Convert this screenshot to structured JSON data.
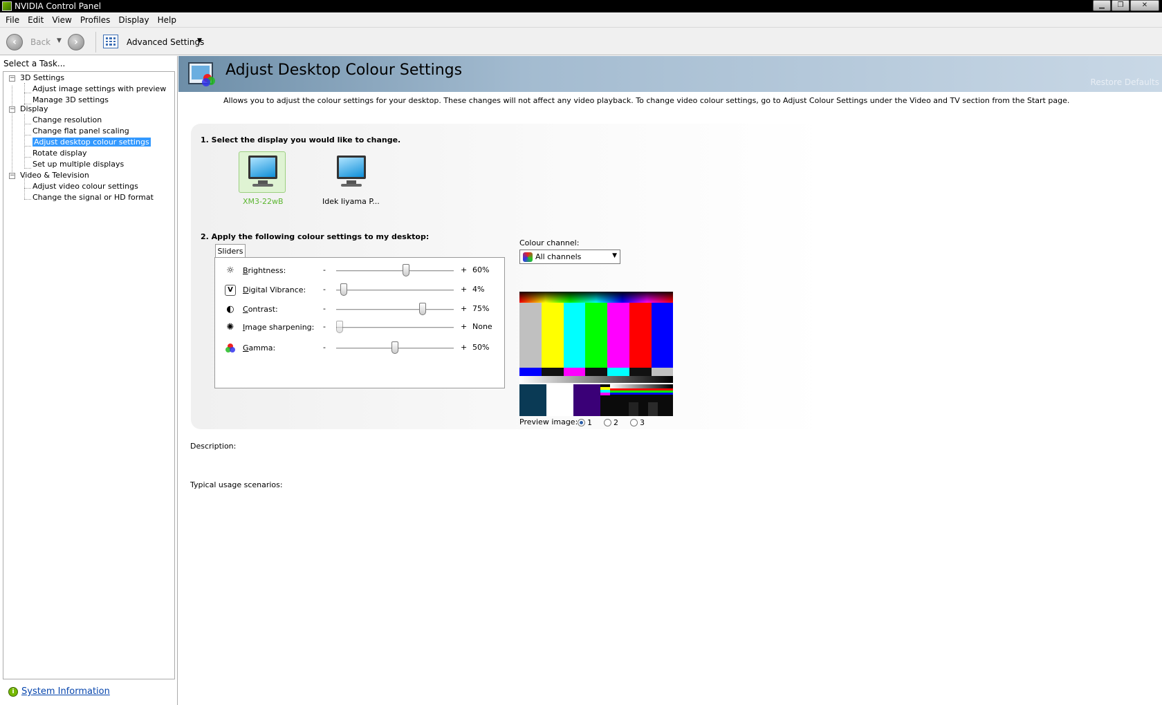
{
  "window": {
    "title": "NVIDIA Control Panel",
    "controls": [
      "minimize",
      "maximize",
      "close"
    ]
  },
  "menubar": [
    "File",
    "Edit",
    "View",
    "Profiles",
    "Display",
    "Help"
  ],
  "toolbar": {
    "back_label": "Back",
    "view_label": "Advanced Settings"
  },
  "sidebar": {
    "header": "Select a Task...",
    "tree": [
      {
        "label": "3D Settings",
        "children": [
          "Adjust image settings with preview",
          "Manage 3D settings"
        ]
      },
      {
        "label": "Display",
        "children": [
          "Change resolution",
          "Change flat panel scaling",
          "Adjust desktop colour settings",
          "Rotate display",
          "Set up multiple displays"
        ]
      },
      {
        "label": "Video & Television",
        "children": [
          "Adjust video colour settings",
          "Change the signal or HD format"
        ]
      }
    ],
    "selected": "Adjust desktop colour settings",
    "footer_link": "System Information"
  },
  "page": {
    "title": "Adjust Desktop Colour Settings",
    "restore_defaults": "Restore Defaults",
    "intro": "Allows you to adjust the colour settings for your desktop. These changes will not affect any video playback. To change video colour settings, go to Adjust Colour Settings under the Video and TV section from the Start page.",
    "step1": "1. Select the display you would like to change.",
    "displays": [
      {
        "name": "XM3-22wB",
        "selected": true
      },
      {
        "name": "Idek Iiyama P...",
        "selected": false
      }
    ],
    "step2": "2. Apply the following colour settings to my desktop:",
    "tab_label": "Sliders",
    "sliders": [
      {
        "label": "Brightness:",
        "value_text": "60%",
        "value": 0.6,
        "icon": "sun-icon"
      },
      {
        "label": "Digital Vibrance:",
        "value_text": "4%",
        "value": 0.04,
        "icon": "vibrance-icon"
      },
      {
        "label": "Contrast:",
        "value_text": "75%",
        "value": 0.75,
        "icon": "contrast-icon"
      },
      {
        "label": "Image sharpening:",
        "value_text": "None",
        "value": 0.0,
        "icon": "sharpen-icon"
      },
      {
        "label": "Gamma:",
        "value_text": "50%",
        "value": 0.5,
        "icon": "gamma-icon"
      }
    ],
    "minus": "-",
    "plus": "+",
    "channel_label": "Colour channel:",
    "channel_value": "All channels",
    "preview_label": "Preview image:",
    "preview_options": [
      "1",
      "2",
      "3"
    ],
    "preview_selected": "1",
    "description_label": "Description:",
    "usage_label": "Typical usage scenarios:"
  }
}
